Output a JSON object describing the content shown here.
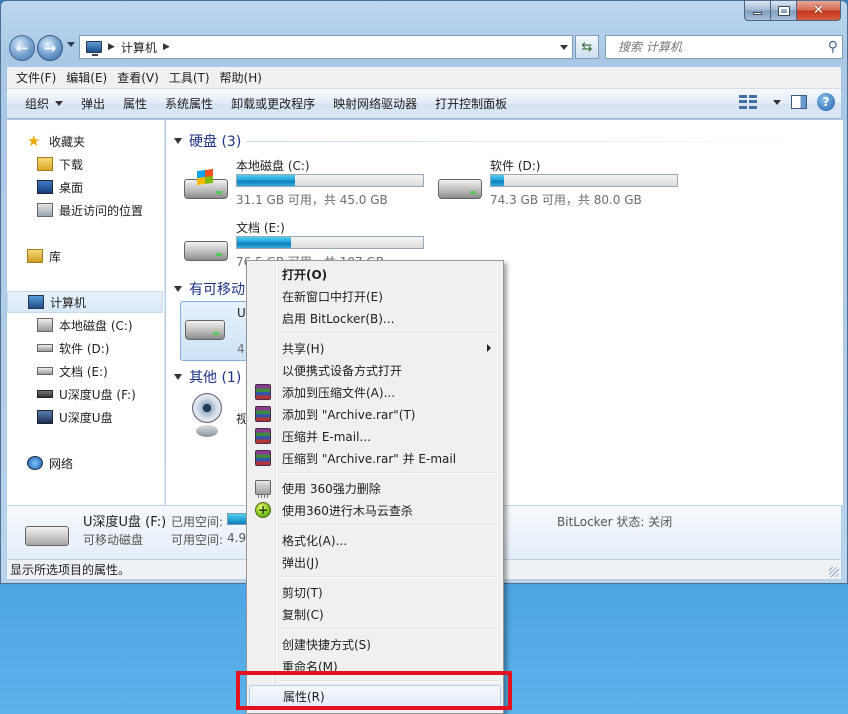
{
  "window": {
    "address_crumb": "计算机",
    "search_placeholder": "搜索 计算机"
  },
  "menubar": [
    "文件(F)",
    "编辑(E)",
    "查看(V)",
    "工具(T)",
    "帮助(H)"
  ],
  "toolbar": [
    "组织",
    "弹出",
    "属性",
    "系统属性",
    "卸载或更改程序",
    "映射网络驱动器",
    "打开控制面板"
  ],
  "navpane": {
    "favorites": "收藏夹",
    "downloads": "下载",
    "desktop": "桌面",
    "recent": "最近访问的位置",
    "libraries": "库",
    "computer": "计算机",
    "drive_c": "本地磁盘 (C:)",
    "drive_d": "软件 (D:)",
    "drive_e": "文档 (E:)",
    "drive_f": "U深度U盘 (F:)",
    "drive_usb": "U深度U盘",
    "network": "网络"
  },
  "groups": {
    "hard_disks": "硬盘 (3)",
    "removable": "有可移动",
    "other": "其他 (1)"
  },
  "drives": [
    {
      "name": "本地磁盘 (C:)",
      "info": "31.1 GB 可用，共 45.0 GB",
      "used_fraction": 0.31
    },
    {
      "name": "软件 (D:)",
      "info": "74.3 GB 可用，共 80.0 GB",
      "used_fraction": 0.07
    },
    {
      "name": "文档 (E:)",
      "info": "76.5 GB 可用，共 107 GB",
      "used_fraction": 0.29
    }
  ],
  "removable_item": {
    "label_fragment": "U",
    "info_fragment": "4."
  },
  "other_item": {
    "label_fragment": "视"
  },
  "details": {
    "name": "U深度U盘 (F:)",
    "type": "可移动磁盘",
    "used_label": "已用空间:",
    "free_label": "可用空间:",
    "free_value": "4.95",
    "bitlocker_label": "BitLocker 状态: 关闭"
  },
  "status": "显示所选项目的属性。",
  "context_menu": {
    "open": "打开(O)",
    "open_new_window": "在新窗口中打开(E)",
    "bitlocker": "启用 BitLocker(B)...",
    "share": "共享(H)",
    "portable": "以便携式设备方式打开",
    "add_archive": "添加到压缩文件(A)...",
    "add_archive_rar": "添加到 \"Archive.rar\"(T)",
    "compress_email": "压缩并 E-mail...",
    "compress_rar_email": "压缩到 \"Archive.rar\" 并 E-mail",
    "force_delete": "使用 360强力删除",
    "trojan_scan": "使用360进行木马云查杀",
    "format": "格式化(A)...",
    "eject": "弹出(J)",
    "cut": "剪切(T)",
    "copy": "复制(C)",
    "create_shortcut": "创建快捷方式(S)",
    "rename": "重命名(M)",
    "properties": "属性(R)"
  },
  "colors": {
    "highlight_box": "#e2131f",
    "drive_bar_fill": "#26a0da"
  }
}
